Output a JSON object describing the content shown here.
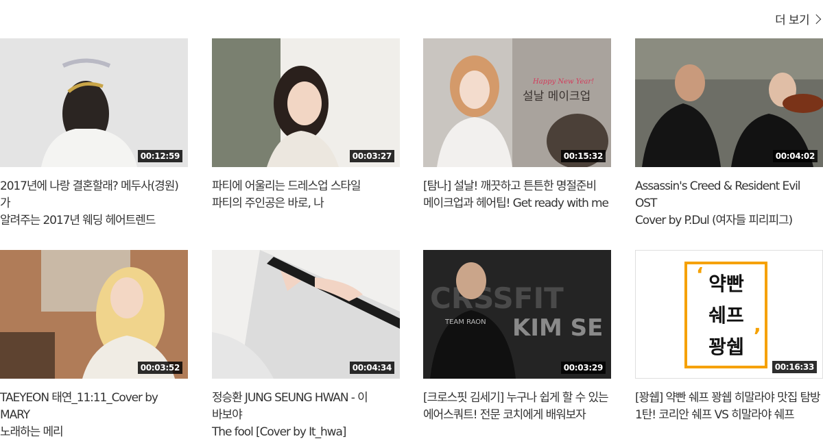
{
  "header": {
    "more_label": "더 보기"
  },
  "videos": [
    {
      "duration": "00:12:59",
      "title": "2017년에 나랑 결혼할래? 메두사(경원)가\n알려주는 2017년 웨딩 헤어트렌드"
    },
    {
      "duration": "00:03:27",
      "title": "파티에 어울리는 드레스업 스타일\n파티의 주인공은 바로, 나"
    },
    {
      "duration": "00:15:32",
      "title": "[탐나] 설날! 깨끗하고 튼튼한 명절준비\n메이크업과 헤어팁! Get ready with me",
      "overlay_sub": "Happy New Year!",
      "overlay_main": "설날 메이크업"
    },
    {
      "duration": "00:04:02",
      "title": "Assassin's Creed & Resident Evil OST\nCover by P.Dul (여자들 피리피그)"
    },
    {
      "duration": "00:03:52",
      "title": "TAEYEON 태연_11:11_Cover by MARY\n노래하는 메리"
    },
    {
      "duration": "00:04:34",
      "title": "정승환 JUNG SEUNG HWAN - 이 바보야\nThe fool [Cover by It_hwa]"
    },
    {
      "duration": "00:03:29",
      "title": "[크로스핏 김세기] 누구나 쉽게 할 수 있는\n에어스쿼트! 전문 코치에게 배워보자",
      "overlay_bg1": "CRSSFIT",
      "overlay_bg2": "KIM SE KI",
      "shirt": "TEAM RAON"
    },
    {
      "duration": "00:16:33",
      "title": "[꽝쉡] 약빤 쉐프 꽝쉡 히말라야 맛집 탐방\n1탄! 코리안 쉐프 VS 히말라야 쉐프",
      "logo_lines": [
        "약빤",
        "쉐프",
        "꽝쉡"
      ]
    }
  ],
  "colors": {
    "accent_orange": "#f5a100",
    "duration_bg": "#000000"
  }
}
